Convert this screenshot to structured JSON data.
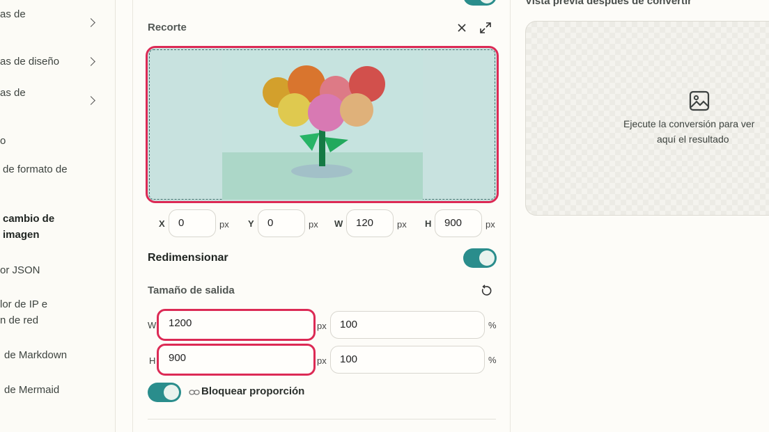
{
  "sidebar": {
    "items": [
      {
        "label": "as de",
        "chevron": true
      },
      {
        "label": "as de diseño",
        "chevron": true
      },
      {
        "label": "as de",
        "chevron": true
      },
      {
        "label": "o"
      },
      {
        "label": "de formato de"
      },
      {
        "label_line1": "cambio de",
        "label_line2": "imagen",
        "active": true
      },
      {
        "label": "or JSON"
      },
      {
        "label_line1": "lor de IP e",
        "label_line2": "n de red"
      },
      {
        "label": "de Markdown"
      },
      {
        "label": "de Mermaid"
      }
    ]
  },
  "crop": {
    "title": "Recorte",
    "close_icon": "close-icon",
    "expand_icon": "expand-icon",
    "fields": [
      {
        "axis": "X",
        "value": "0",
        "unit": "px"
      },
      {
        "axis": "Y",
        "value": "0",
        "unit": "px"
      },
      {
        "axis": "W",
        "value": "120",
        "unit": "px"
      },
      {
        "axis": "H",
        "value": "900",
        "unit": "px"
      }
    ]
  },
  "resize": {
    "title": "Redimensionar",
    "enabled": true
  },
  "output_size": {
    "title": "Tamaño de salida",
    "reset_icon": "reset-icon",
    "width": {
      "axis": "W",
      "px": "1200",
      "px_unit": "px",
      "percent": "100",
      "percent_unit": "%"
    },
    "height": {
      "axis": "H",
      "px": "900",
      "px_unit": "px",
      "percent": "100",
      "percent_unit": "%"
    },
    "lock_label": "Bloquear proporción",
    "lock_enabled": true
  },
  "preview": {
    "title": "Vista previa después de convertir",
    "placeholder_line1": "Ejecute la conversión para ver",
    "placeholder_line2": "aquí el resultado",
    "image_icon": "image-icon"
  },
  "colors": {
    "accent": "#2a8d8c",
    "highlight": "#dc2a55"
  }
}
